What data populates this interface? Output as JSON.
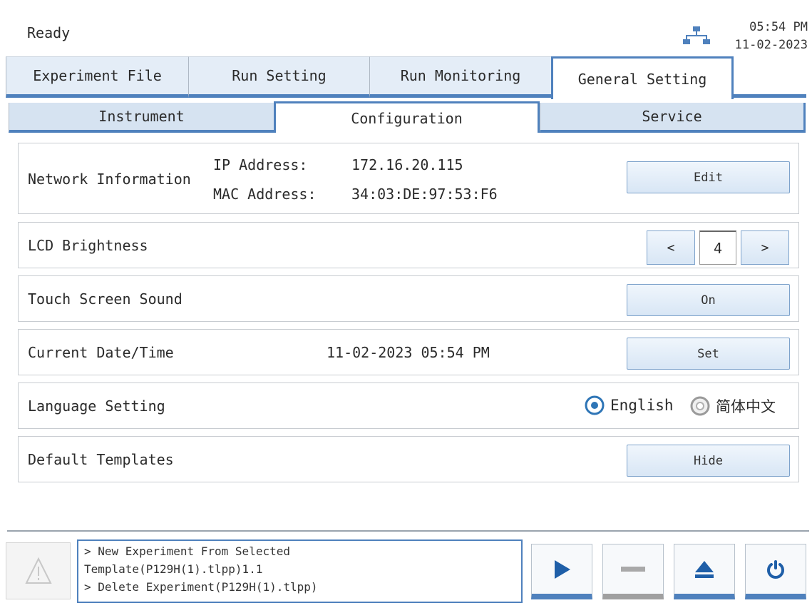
{
  "status": {
    "text": "Ready",
    "time": "05:54 PM",
    "date": "11-02-2023"
  },
  "main_tabs": [
    {
      "label": "Experiment File"
    },
    {
      "label": "Run Setting"
    },
    {
      "label": "Run Monitoring"
    },
    {
      "label": "General Setting"
    }
  ],
  "sub_tabs": [
    {
      "label": "Instrument"
    },
    {
      "label": "Configuration"
    },
    {
      "label": "Service"
    }
  ],
  "network": {
    "label": "Network Information",
    "ip_label": "IP Address:",
    "ip_value": "172.16.20.115",
    "mac_label": "MAC Address:",
    "mac_value": "34:03:DE:97:53:F6",
    "button": "Edit"
  },
  "brightness": {
    "label": "LCD Brightness",
    "dec": "<",
    "value": "4",
    "inc": ">"
  },
  "sound": {
    "label": "Touch Screen Sound",
    "button": "On"
  },
  "datetime": {
    "label": "Current Date/Time",
    "value": "11-02-2023 05:54 PM",
    "button": "Set"
  },
  "language": {
    "label": "Language Setting",
    "options": [
      "English",
      "简体中文"
    ],
    "selected": "English"
  },
  "templates": {
    "label": "Default Templates",
    "button": "Hide"
  },
  "log": {
    "lines": [
      "> New Experiment From Selected",
      "Template(P129H(1).tlpp)1.1",
      "> Delete Experiment(P129H(1).tlpp)"
    ]
  },
  "icons": {
    "network": "network-icon",
    "warning": "warning-icon",
    "play": "play-icon",
    "stop": "stop-icon",
    "eject": "eject-icon",
    "power": "power-icon"
  },
  "colors": {
    "accent": "#4f81bd",
    "radio_selected": "#2e75b6",
    "radio_unselected": "#9a9a9a"
  }
}
